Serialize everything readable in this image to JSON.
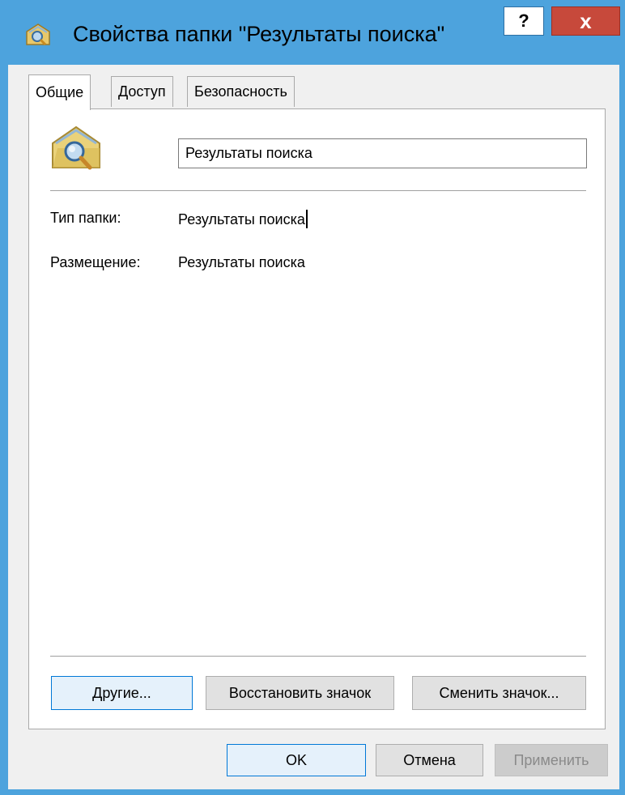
{
  "window": {
    "title": "Свойства папки \"Результаты поиска\"",
    "help_label": "?",
    "close_label": "x"
  },
  "tabs": [
    {
      "label": "Общие",
      "active": true
    },
    {
      "label": "Доступ",
      "active": false
    },
    {
      "label": "Безопасность",
      "active": false
    }
  ],
  "general": {
    "folder_name": "Результаты поиска",
    "properties": [
      {
        "label": "Тип папки:",
        "value": "Результаты поиска"
      },
      {
        "label": "Размещение:",
        "value": "Результаты поиска"
      }
    ],
    "buttons": {
      "other": "Другие...",
      "restore_icon": "Восстановить значок",
      "change_icon": "Сменить значок..."
    }
  },
  "footer": {
    "ok": "OK",
    "cancel": "Отмена",
    "apply": "Применить",
    "apply_enabled": false
  },
  "colors": {
    "frame": "#4da3dd",
    "close_button": "#c7493b",
    "dialog_bg": "#f0f0f0",
    "focus_border": "#0078d7"
  },
  "icons": {
    "title": "search-folder-icon",
    "folder": "search-folder-icon"
  }
}
